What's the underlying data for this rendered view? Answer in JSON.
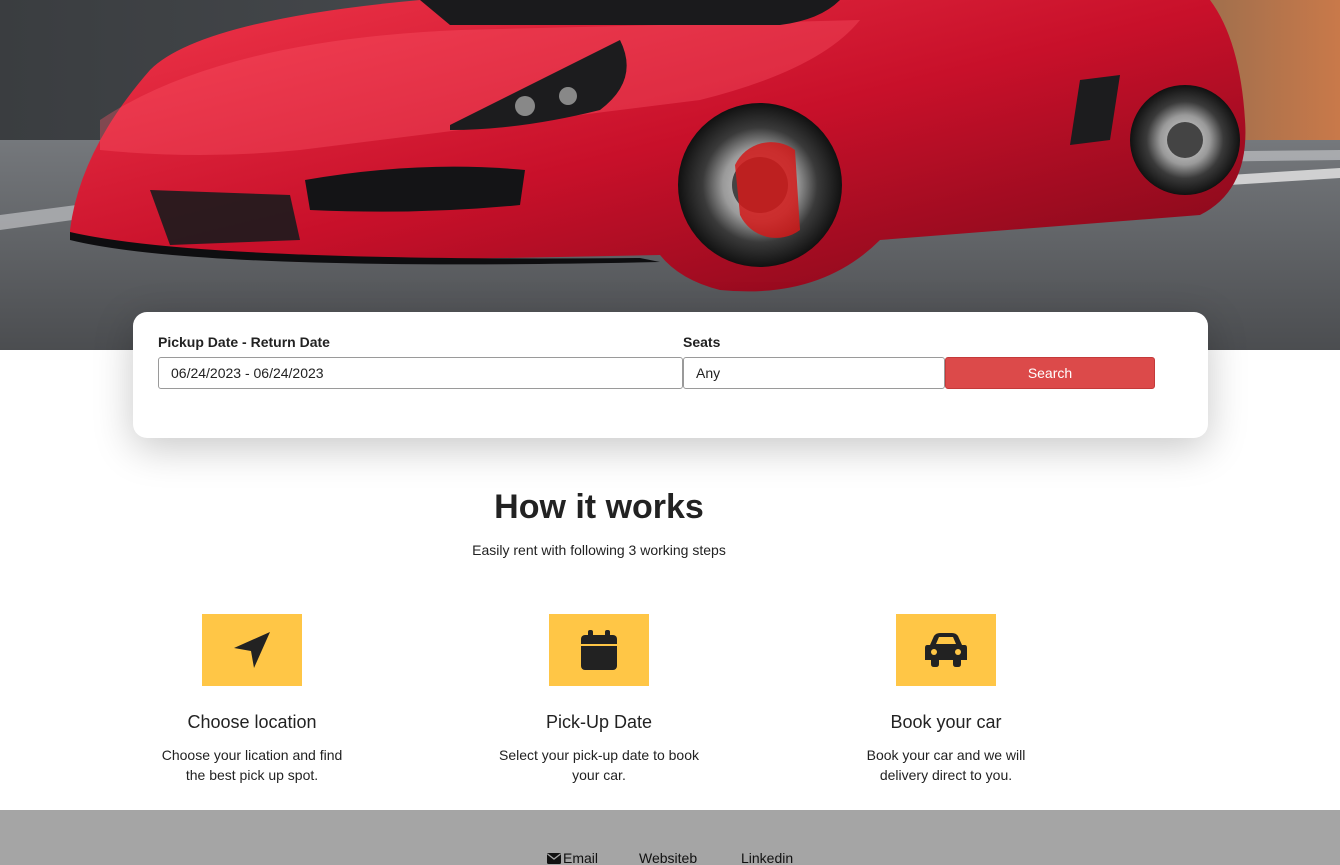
{
  "search": {
    "date_label": "Pickup Date - Return Date",
    "date_value": "06/24/2023 - 06/24/2023",
    "seats_label": "Seats",
    "seats_value": "Any",
    "button_label": "Search"
  },
  "how_it_works": {
    "title": "How it works",
    "subtitle": "Easily rent with following 3 working steps",
    "steps": [
      {
        "icon": "location-arrow-icon",
        "title": "Choose location",
        "description": "Choose your lication and find the best pick up spot."
      },
      {
        "icon": "calendar-icon",
        "title": "Pick-Up Date",
        "description": "Select your pick-up date to book your car."
      },
      {
        "icon": "car-icon",
        "title": "Book your car",
        "description": "Book your car and we will delivery direct to you."
      }
    ]
  },
  "footer": {
    "links": [
      "Email",
      "Websiteb",
      "Linkedin"
    ]
  },
  "colors": {
    "accent_red": "#dc4a4a",
    "icon_yellow": "#ffc646",
    "footer_gray": "#a5a5a5",
    "car_red": "#d4142a"
  }
}
